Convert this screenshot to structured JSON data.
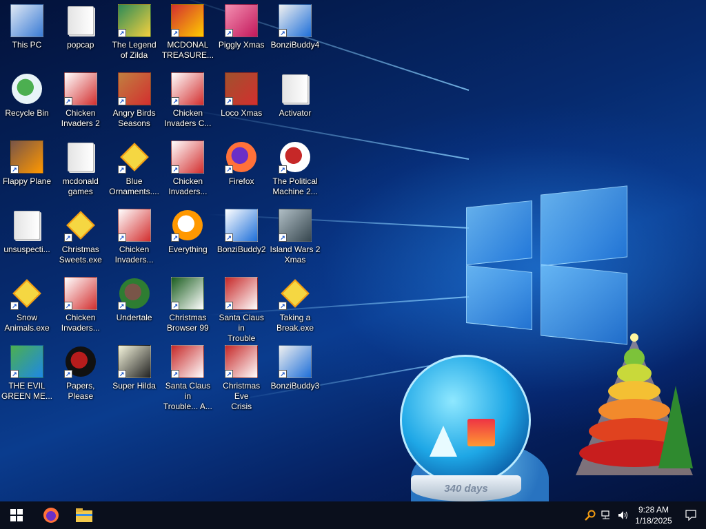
{
  "desktop": {
    "icons": [
      {
        "label": "This PC",
        "icon": "this-pc-icon",
        "shortcut": false
      },
      {
        "label": "popcap",
        "icon": "folder-icon",
        "shortcut": false
      },
      {
        "label": "The Legend\nof Zilda",
        "icon": "zilda-icon",
        "shortcut": true
      },
      {
        "label": "MCDONAL\nTREASURE...",
        "icon": "mcdonalds-icon",
        "shortcut": true
      },
      {
        "label": "Piggly Xmas",
        "icon": "piggly-icon",
        "shortcut": true
      },
      {
        "label": "BonziBuddy4",
        "icon": "app-window-icon",
        "shortcut": true
      },
      {
        "label": "Recycle Bin",
        "icon": "recycle-bin-icon",
        "shortcut": false
      },
      {
        "label": "Chicken\nInvaders 2",
        "icon": "chicken-icon",
        "shortcut": true
      },
      {
        "label": "Angry Birds\nSeasons",
        "icon": "angry-birds-icon",
        "shortcut": true
      },
      {
        "label": "Chicken\nInvaders C...",
        "icon": "chicken-icon",
        "shortcut": true
      },
      {
        "label": "Loco Xmas",
        "icon": "bear-icon",
        "shortcut": true
      },
      {
        "label": "Activator",
        "icon": "file-icon",
        "shortcut": false
      },
      {
        "label": "Flappy Plane",
        "icon": "plane-icon",
        "shortcut": true
      },
      {
        "label": "mcdonald\ngames",
        "icon": "folder-icon",
        "shortcut": false
      },
      {
        "label": "Blue\nOrnaments....",
        "icon": "exe-icon",
        "shortcut": true
      },
      {
        "label": "Chicken\nInvaders...",
        "icon": "chicken-icon",
        "shortcut": true
      },
      {
        "label": "Firefox",
        "icon": "firefox-icon",
        "shortcut": true
      },
      {
        "label": "The Political\nMachine 2...",
        "icon": "political-icon",
        "shortcut": true
      },
      {
        "label": "unsuspecti...",
        "icon": "file-icon",
        "shortcut": false
      },
      {
        "label": "Christmas\nSweets.exe",
        "icon": "exe-icon",
        "shortcut": true
      },
      {
        "label": "Chicken\nInvaders...",
        "icon": "chicken-icon",
        "shortcut": true
      },
      {
        "label": "Everything",
        "icon": "everything-icon",
        "shortcut": true
      },
      {
        "label": "BonziBuddy2",
        "icon": "app-file-icon",
        "shortcut": true
      },
      {
        "label": "Island Wars 2\nXmas",
        "icon": "island-icon",
        "shortcut": true
      },
      {
        "label": "Snow\nAnimals.exe",
        "icon": "exe-icon",
        "shortcut": true
      },
      {
        "label": "Chicken\nInvaders...",
        "icon": "chicken-icon",
        "shortcut": true
      },
      {
        "label": "Undertale",
        "icon": "undertale-icon",
        "shortcut": true
      },
      {
        "label": "Christmas\nBrowser 99",
        "icon": "xmas-tree-icon",
        "shortcut": true
      },
      {
        "label": "Santa Claus in\nTrouble",
        "icon": "santa-icon",
        "shortcut": true
      },
      {
        "label": "Taking a\nBreak.exe",
        "icon": "exe-icon",
        "shortcut": true
      },
      {
        "label": "THE EVIL\nGREEN ME...",
        "icon": "messenger-icon",
        "shortcut": true
      },
      {
        "label": "Papers, Please",
        "icon": "papers-please-icon",
        "shortcut": true
      },
      {
        "label": "Super Hilda",
        "icon": "hilda-icon",
        "shortcut": true
      },
      {
        "label": "Santa Claus in\nTrouble... A...",
        "icon": "santa-icon",
        "shortcut": true
      },
      {
        "label": "Christmas Eve\nCrisis",
        "icon": "santa-icon",
        "shortcut": true
      },
      {
        "label": "BonziBuddy3",
        "icon": "app-window-icon",
        "shortcut": true
      }
    ],
    "globe_text": "340 days"
  },
  "taskbar": {
    "start_icon": "windows-start-icon",
    "pinned": [
      "firefox-icon",
      "file-explorer-icon"
    ],
    "tray_icons": [
      "search-tray-icon",
      "network-icon",
      "volume-icon"
    ],
    "time": "9:28 AM",
    "date": "1/18/2025",
    "notification_icon": "notification-icon"
  }
}
